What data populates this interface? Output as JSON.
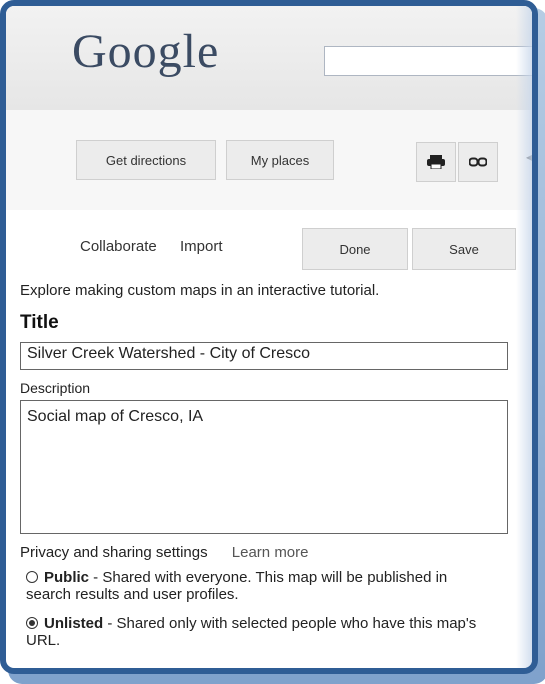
{
  "header": {
    "logo": "Google",
    "search_value": ""
  },
  "toolbar": {
    "directions_label": "Get directions",
    "myplaces_label": "My places",
    "icons": [
      "print-icon",
      "link-icon",
      "chevron-left-icon"
    ]
  },
  "actions": {
    "collaborate_label": "Collaborate",
    "import_label": "Import",
    "done_label": "Done",
    "save_label": "Save"
  },
  "form": {
    "tutorial_text": "Explore making custom maps in an interactive tutorial.",
    "title_label": "Title",
    "title_value": "Silver Creek Watershed - City of Cresco",
    "description_label": "Description",
    "description_value": "Social map of Cresco, IA",
    "privacy_label": "Privacy and sharing settings",
    "learn_more_label": "Learn more",
    "public_title": "Public",
    "public_desc": " - Shared with everyone. This map will be published in search results and user profiles.",
    "unlisted_title": "Unlisted",
    "unlisted_desc": " - Shared only with selected people who have this map's URL.",
    "selected_privacy": "Unlisted"
  },
  "colors": {
    "frame": "#2f5d95",
    "text": "#222222",
    "button_bg": "#ececec"
  }
}
